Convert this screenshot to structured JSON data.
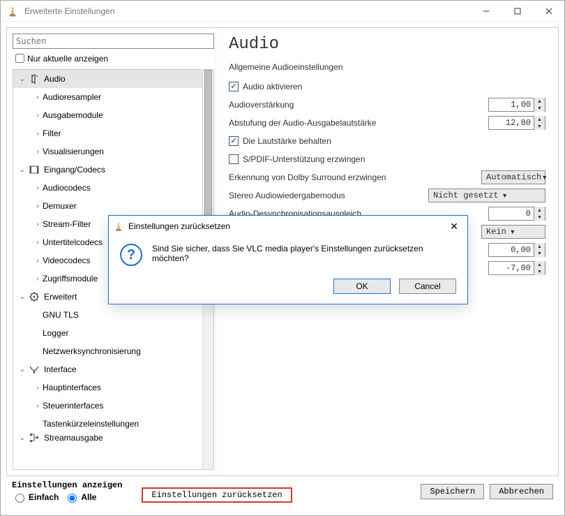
{
  "window": {
    "title": "Erweiterte Einstellungen"
  },
  "left": {
    "search_placeholder": "Suchen",
    "show_current_label": "Nur aktuelle anzeigen",
    "tree": [
      {
        "label": "Audio",
        "level": 1,
        "expanded": true,
        "icon": "audio",
        "selected": true
      },
      {
        "label": "Audioresampler",
        "level": 2,
        "expanded": false
      },
      {
        "label": "Ausgabemodule",
        "level": 2,
        "expanded": false
      },
      {
        "label": "Filter",
        "level": 2,
        "expanded": false
      },
      {
        "label": "Visualisierungen",
        "level": 2,
        "expanded": false
      },
      {
        "label": "Eingang/Codecs",
        "level": 1,
        "expanded": true,
        "icon": "codecs"
      },
      {
        "label": "Audiocodecs",
        "level": 2,
        "expanded": false
      },
      {
        "label": "Demuxer",
        "level": 2,
        "expanded": false
      },
      {
        "label": "Stream-Filter",
        "level": 2,
        "expanded": false
      },
      {
        "label": "Untertitelcodecs",
        "level": 2,
        "expanded": false
      },
      {
        "label": "Videocodecs",
        "level": 2,
        "expanded": false
      },
      {
        "label": "Zugriffsmodule",
        "level": 2,
        "expanded": false
      },
      {
        "label": "Erweitert",
        "level": 1,
        "expanded": true,
        "icon": "advanced"
      },
      {
        "label": "GNU TLS",
        "level": 2,
        "leaf": true
      },
      {
        "label": "Logger",
        "level": 2,
        "leaf": true
      },
      {
        "label": "Netzwerksynchronisierung",
        "level": 2,
        "leaf": true
      },
      {
        "label": "Interface",
        "level": 1,
        "expanded": true,
        "icon": "interface"
      },
      {
        "label": "Hauptinterfaces",
        "level": 2,
        "expanded": false
      },
      {
        "label": "Steuerinterfaces",
        "level": 2,
        "expanded": false
      },
      {
        "label": "Tastenkürzeleinstellungen",
        "level": 2,
        "leaf": true
      },
      {
        "label": "Streamausgabe",
        "level": 1,
        "expanded": true,
        "icon": "stream",
        "partial": true
      }
    ]
  },
  "right": {
    "title": "Audio",
    "section": "Allgemeine Audioeinstellungen",
    "rows": {
      "activate": "Audio aktivieren",
      "gain": "Audioverstärkung",
      "gain_val": "1,00",
      "step": "Abstufung der Audio-Ausgabelautstärke",
      "step_val": "12,80",
      "keep_vol": "Die Lautstärke behalten",
      "spdif": "S/PDIF-Unterstützung erzwingen",
      "dolby": "Erkennung von Dolby Surround erzwingen",
      "dolby_val": "Automatisch",
      "stereo": "Stereo Audiowiedergabemodus",
      "stereo_val": "Nicht gesetzt",
      "desync": "Audio-Desynchronisationsausgleich",
      "desync_val": "0",
      "combo4_val": "Kein",
      "spin4_val": "0,00",
      "spin5_val": "-7,00"
    }
  },
  "bottom": {
    "show_label": "Einstellungen anzeigen",
    "radio_simple": "Einfach",
    "radio_all": "Alle",
    "reset": "Einstellungen zurücksetzen",
    "save": "Speichern",
    "cancel": "Abbrechen"
  },
  "modal": {
    "title": "Einstellungen zurücksetzen",
    "message": "Sind Sie sicher, dass Sie VLC media player's Einstellungen zurücksetzen möchten?",
    "ok": "OK",
    "cancel": "Cancel"
  }
}
